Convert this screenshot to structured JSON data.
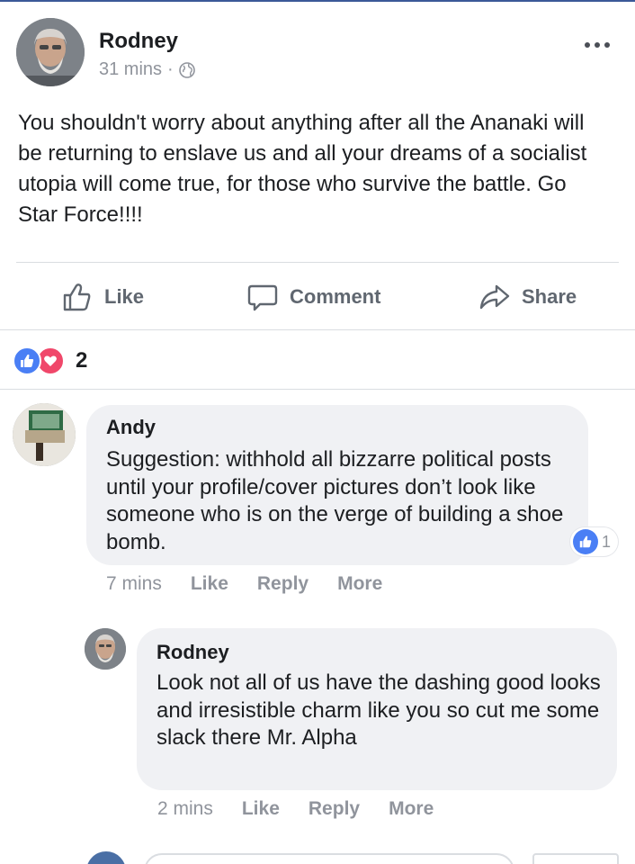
{
  "post": {
    "author": "Rodney",
    "time": "31 mins",
    "separator": "·",
    "privacy_icon": "globe-icon",
    "options_icon": "more-options-icon",
    "text": "You shouldn't worry about anything after all the Ananaki will be returning to enslave us and all your dreams of a socialist utopia will come true, for those who survive the battle. Go Star Force!!!!"
  },
  "actions": {
    "like": "Like",
    "comment": "Comment",
    "share": "Share"
  },
  "reactions": {
    "icons": [
      "like-reaction-icon",
      "love-reaction-icon"
    ],
    "count": "2"
  },
  "comments": [
    {
      "author": "Andy",
      "text": "Suggestion: withhold all bizzarre political posts until your profile/cover pictures don’t look like someone who is on the verge of building a shoe bomb.",
      "time": "7 mins",
      "like": "Like",
      "reply": "Reply",
      "more": "More",
      "like_count": "1"
    },
    {
      "author": "Rodney",
      "text": "Look not all of us have the dashing good looks and irresistible charm like you so cut me some slack there Mr. Alpha",
      "time": "2 mins",
      "like": "Like",
      "reply": "Reply",
      "more": "More"
    }
  ],
  "colors": {
    "facebook_blue": "#4a7ff5",
    "love_red": "#f0476a",
    "bubble_gray": "#f0f1f4",
    "meta_gray": "#90949c"
  }
}
